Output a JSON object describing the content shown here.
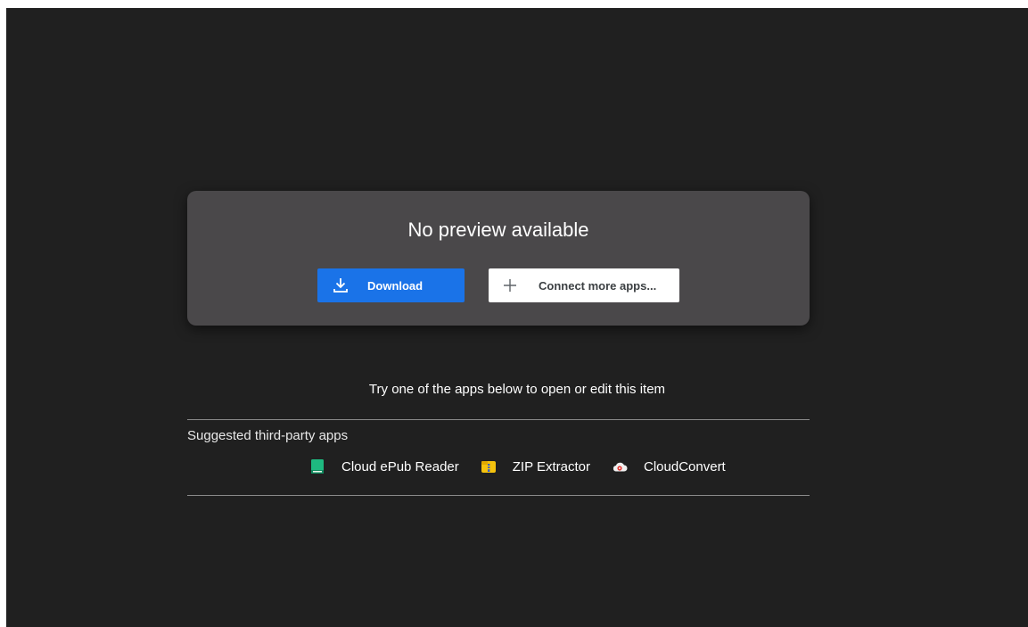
{
  "preview": {
    "title": "No preview available",
    "download_label": "Download",
    "connect_label": "Connect more apps..."
  },
  "suggestions": {
    "prompt": "Try one of the apps below to open or edit this item",
    "section_label": "Suggested third-party apps",
    "apps": [
      {
        "label": "Cloud ePub Reader",
        "icon": "book-icon",
        "color": "#1eb980"
      },
      {
        "label": "ZIP Extractor",
        "icon": "zip-icon",
        "color": "#f4c20d"
      },
      {
        "label": "CloudConvert",
        "icon": "cloud-icon",
        "color": "#e53935"
      }
    ]
  },
  "colors": {
    "background": "#202020",
    "card": "#4a484a",
    "accent": "#1a73e8"
  }
}
